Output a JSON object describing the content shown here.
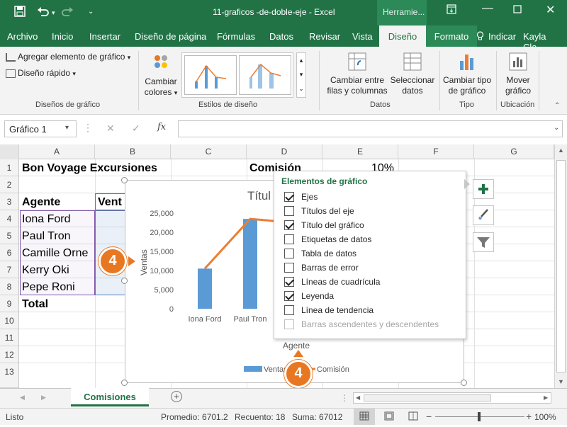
{
  "window": {
    "title": "11-graficos -de-doble-eje  -  Excel",
    "contextual_tab_group": "Herramie...",
    "save_icon": "save-icon",
    "undo_icon": "undo-icon",
    "redo_icon": "redo-icon"
  },
  "tabs": [
    "Archivo",
    "Inicio",
    "Insertar",
    "Diseño de página",
    "Fórmulas",
    "Datos",
    "Revisar",
    "Vista",
    "Diseño",
    "Formato"
  ],
  "tell_me": "Indicar",
  "user": "Kayla Cla...",
  "ribbon": {
    "add_element": "Agregar elemento de gráfico",
    "quick_layout": "Diseño rápido",
    "group_layouts": "Diseños de gráfico",
    "change_colors_1": "Cambiar",
    "change_colors_2": "colores",
    "group_styles": "Estilos de diseño",
    "switch_row_col_1": "Cambiar entre",
    "switch_row_col_2": "filas y columnas",
    "select_data_1": "Seleccionar",
    "select_data_2": "datos",
    "group_data": "Datos",
    "change_type_1": "Cambiar tipo",
    "change_type_2": "de gráfico",
    "group_type": "Tipo",
    "move_chart_1": "Mover",
    "move_chart_2": "gráfico",
    "group_location": "Ubicación"
  },
  "formula_bar": {
    "name_box": "Gráfico 1",
    "fx": "fx",
    "cancel": "✕",
    "confirm": "✓"
  },
  "columns": [
    "A",
    "B",
    "C",
    "D",
    "E",
    "F",
    "G"
  ],
  "rows": [
    "1",
    "2",
    "3",
    "4",
    "5",
    "6",
    "7",
    "8",
    "9",
    "10",
    "11",
    "12",
    "13"
  ],
  "cells": {
    "a1": "Bon Voyage Excursiones",
    "d1": "Comisión",
    "e1": "10%",
    "a3": "Agente",
    "b3": "Vent",
    "a4": "Iona Ford",
    "a5": "Paul Tron",
    "a6": "Camille  Orne",
    "a7": "Kerry Oki",
    "a8": "Pepe Roni",
    "a9": "Total"
  },
  "chart_data": {
    "type": "bar",
    "title": "Títul",
    "xlabel": "Agente",
    "ylabel": "Ventas",
    "categories": [
      "Iona Ford",
      "Paul Tron"
    ],
    "ylim": [
      0,
      25000
    ],
    "yticks": [
      "0",
      "5,000",
      "10,000",
      "15,000",
      "20,000",
      "25,000"
    ],
    "series": [
      {
        "name": "Ventas",
        "type": "bar",
        "color": "#5b9bd5",
        "values": [
          10500,
          23500
        ]
      },
      {
        "name": "Comisión",
        "type": "line",
        "color": "#ed7d31",
        "values": [
          10500,
          23500
        ]
      }
    ],
    "legend": [
      "Ventas",
      "Comisión"
    ],
    "legend_position": "bottom",
    "grid": false
  },
  "popup": {
    "title": "Elementos de gráfico",
    "items": [
      {
        "label": "Ejes",
        "checked": true
      },
      {
        "label": "Títulos del eje",
        "checked": false
      },
      {
        "label": "Título del gráfico",
        "checked": true
      },
      {
        "label": "Etiquetas de datos",
        "checked": false
      },
      {
        "label": "Tabla de datos",
        "checked": false
      },
      {
        "label": "Barras de error",
        "checked": false
      },
      {
        "label": "Líneas de cuadrícula",
        "checked": true
      },
      {
        "label": "Leyenda",
        "checked": true
      },
      {
        "label": "Línea de tendencia",
        "checked": false
      },
      {
        "label": "Barras ascendentes y descendentes",
        "checked": false,
        "disabled": true
      }
    ]
  },
  "badges": [
    "4",
    "4"
  ],
  "sheet_tab": "Comisiones",
  "status": {
    "ready": "Listo",
    "average": "Promedio: 6701.2",
    "count": "Recuento: 18",
    "sum": "Suma: 67012",
    "zoom": "100%"
  },
  "colors": {
    "accent": "#217346",
    "badge": "#e87722"
  }
}
